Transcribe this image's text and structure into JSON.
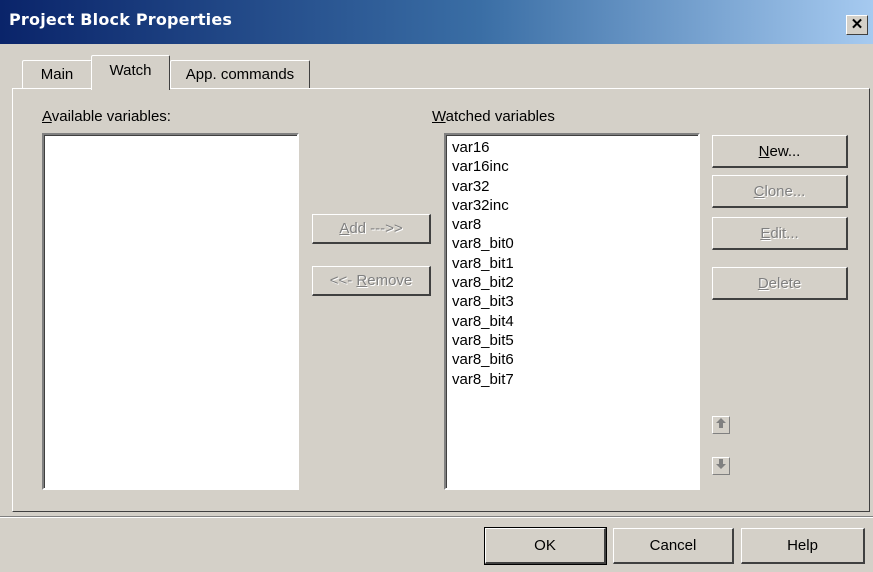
{
  "window": {
    "title": "Project Block Properties",
    "close_glyph": "✕"
  },
  "tabs": [
    {
      "label": "Main",
      "active": false
    },
    {
      "label": "Watch",
      "active": true
    },
    {
      "label": "App. commands",
      "active": false
    }
  ],
  "available": {
    "label_mnemonic": "A",
    "label_rest": "vailable variables:",
    "items": []
  },
  "watched": {
    "label_mnemonic": "W",
    "label_rest": "atched variables",
    "items": [
      "var16",
      "var16inc",
      "var32",
      "var32inc",
      "var8",
      "var8_bit0",
      "var8_bit1",
      "var8_bit2",
      "var8_bit3",
      "var8_bit4",
      "var8_bit5",
      "var8_bit6",
      "var8_bit7"
    ]
  },
  "middle_buttons": {
    "add_mnemonic": "A",
    "add_rest": "dd --->>",
    "remove_prefix": "<<- ",
    "remove_mnemonic": "R",
    "remove_rest": "emove"
  },
  "side_buttons": {
    "new_mnemonic": "N",
    "new_rest": "ew...",
    "clone_mnemonic": "C",
    "clone_rest": "lone...",
    "edit_mnemonic": "E",
    "edit_rest": "dit...",
    "delete_mnemonic": "D",
    "delete_rest": "elete"
  },
  "icons": {
    "move_up": "arrow-up-icon",
    "move_down": "arrow-down-icon"
  },
  "footer": {
    "ok": "OK",
    "cancel": "Cancel",
    "help": "Help"
  },
  "colors": {
    "titlebar_start": "#0a246a",
    "titlebar_end": "#a6caf0",
    "face": "#d4d0c8",
    "disabled_text": "#808080"
  }
}
